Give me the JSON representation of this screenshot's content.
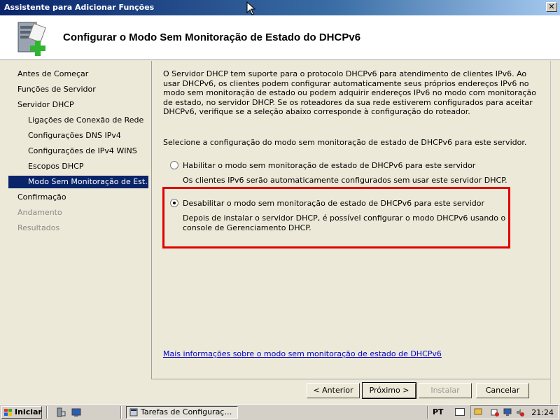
{
  "window": {
    "title": "Assistente para Adicionar Funções",
    "close_label": "✕"
  },
  "header": {
    "heading": "Configurar o Modo Sem Monitoração de Estado do DHCPv6"
  },
  "nav": {
    "items": [
      {
        "label": "Antes de Começar",
        "state": "normal"
      },
      {
        "label": "Funções de Servidor",
        "state": "normal"
      },
      {
        "label": "Servidor DHCP",
        "state": "normal"
      },
      {
        "label": "Ligações de Conexão de Rede",
        "state": "sub"
      },
      {
        "label": "Configurações DNS IPv4",
        "state": "sub"
      },
      {
        "label": "Configurações de IPv4 WINS",
        "state": "sub"
      },
      {
        "label": "Escopos DHCP",
        "state": "sub"
      },
      {
        "label": "Modo Sem Monitoração de Est…",
        "state": "active"
      },
      {
        "label": "Confirmação",
        "state": "normal"
      },
      {
        "label": "Andamento",
        "state": "disabled"
      },
      {
        "label": "Resultados",
        "state": "disabled"
      }
    ]
  },
  "main": {
    "description": "O Servidor DHCP tem suporte para o protocolo DHCPv6 para atendimento de clientes IPv6. Ao usar DHCPv6, os clientes podem configurar automaticamente seus próprios endereços IPv6 no modo sem monitoração de estado ou podem adquirir endereços IPv6 no modo com monitoração de estado, no servidor DHCP. Se os roteadores da sua rede estiverem configurados para aceitar DHCPv6, verifique se a seleção abaixo corresponde à configuração do roteador.",
    "select_label": "Selecione a configuração do modo sem monitoração de estado de DHCPv6 para este servidor.",
    "options": [
      {
        "label": "Habilitar o modo sem monitoração de estado de DHCPv6 para este servidor",
        "description": "Os clientes IPv6 serão automaticamente configurados sem usar este servidor DHCP.",
        "selected": false
      },
      {
        "label": "Desabilitar o modo sem monitoração de estado de DHCPv6 para este servidor",
        "description": "Depois de instalar o servidor DHCP, é possível configurar o modo DHCPv6 usando o console de Gerenciamento DHCP.",
        "selected": true
      }
    ],
    "info_link": "Mais informações sobre o modo sem monitoração de estado de DHCPv6"
  },
  "buttons": {
    "back": "< Anterior",
    "next": "Próximo >",
    "install": "Instalar",
    "cancel": "Cancelar"
  },
  "taskbar": {
    "start_label": "Iniciar",
    "task_label": "Tarefas de Configuraç…",
    "language": "PT",
    "clock": "21:24"
  },
  "colors": {
    "highlight_box": "#e00000",
    "active_nav": "#0a246a",
    "link": "#0000cc"
  }
}
